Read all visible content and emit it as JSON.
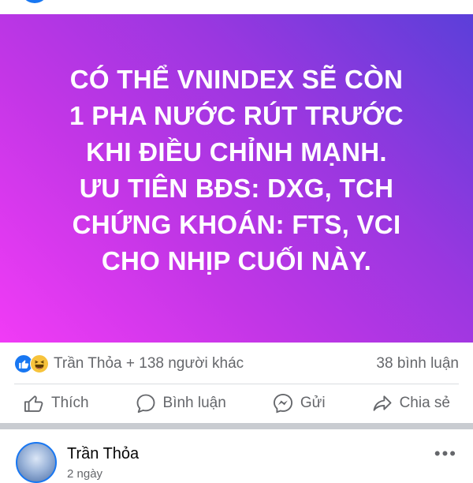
{
  "post": {
    "banner_lines": [
      "CÓ THỂ VNINDEX SẼ CÒN",
      "1 PHA NƯỚC RÚT TRƯỚC",
      "KHI ĐIỀU CHỈNH MẠNH.",
      "ƯU TIÊN BĐS: DXG, TCH",
      "CHỨNG KHOÁN: FTS, VCI",
      "CHO NHỊP CUỐI NÀY."
    ],
    "banner_colors": [
      "#f13bf6",
      "#9a37e0",
      "#5b3fd9"
    ]
  },
  "reactions": {
    "icons": [
      "like-icon",
      "haha-icon"
    ],
    "summary": "Trần Thỏa + 138 người khác",
    "comments_count": "38 bình luận"
  },
  "actions": {
    "like_label": "Thích",
    "comment_label": "Bình luận",
    "send_label": "Gửi",
    "share_label": "Chia sẻ"
  },
  "comment": {
    "author": "Trần Thỏa",
    "time": "2 ngày",
    "more": "•••"
  },
  "colors": {
    "facebook_blue": "#1877f2",
    "muted_text": "#65676b"
  }
}
